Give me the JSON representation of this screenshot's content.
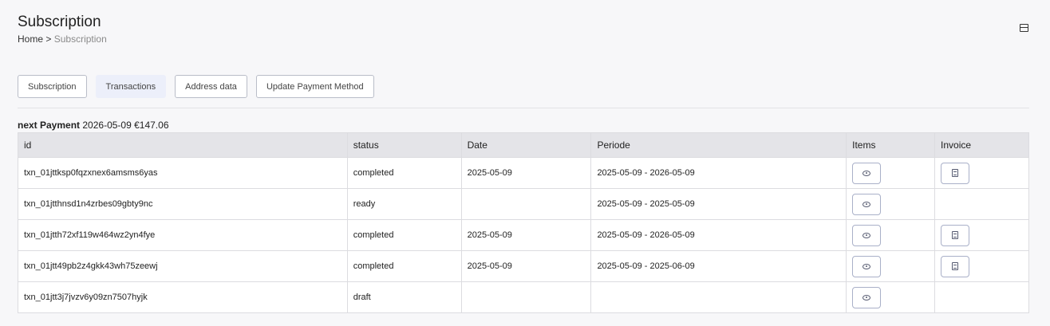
{
  "header": {
    "title": "Subscription",
    "breadcrumb": {
      "home": "Home",
      "separator": ">",
      "current": "Subscription"
    }
  },
  "tabs": [
    {
      "label": "Subscription",
      "active": false
    },
    {
      "label": "Transactions",
      "active": true
    },
    {
      "label": "Address data",
      "active": false
    },
    {
      "label": "Update Payment Method",
      "active": false
    }
  ],
  "next_payment": {
    "label": "next Payment",
    "date": "2026-05-09",
    "amount": "€147.06"
  },
  "table": {
    "columns": [
      "id",
      "status",
      "Date",
      "Periode",
      "Items",
      "Invoice"
    ],
    "rows": [
      {
        "id": "txn_01jttksp0fqzxnex6amsms6yas",
        "status": "completed",
        "date": "2025-05-09",
        "periode": "2025-05-09 - 2026-05-09",
        "invoice": true
      },
      {
        "id": "txn_01jtthnsd1n4zrbes09gbty9nc",
        "status": "ready",
        "date": "",
        "periode": "2025-05-09 - 2025-05-09",
        "invoice": false
      },
      {
        "id": "txn_01jtth72xf119w464wz2yn4fye",
        "status": "completed",
        "date": "2025-05-09",
        "periode": "2025-05-09 - 2026-05-09",
        "invoice": true
      },
      {
        "id": "txn_01jtt49pb2z4gkk43wh75zeewj",
        "status": "completed",
        "date": "2025-05-09",
        "periode": "2025-05-09 - 2025-06-09",
        "invoice": true
      },
      {
        "id": "txn_01jtt3j7jvzv6y09zn7507hyjk",
        "status": "draft",
        "date": "",
        "periode": "",
        "invoice": false
      }
    ]
  },
  "icons": {
    "corner": "window-toggle-icon",
    "items": "eye-icon",
    "invoice": "document-icon"
  }
}
